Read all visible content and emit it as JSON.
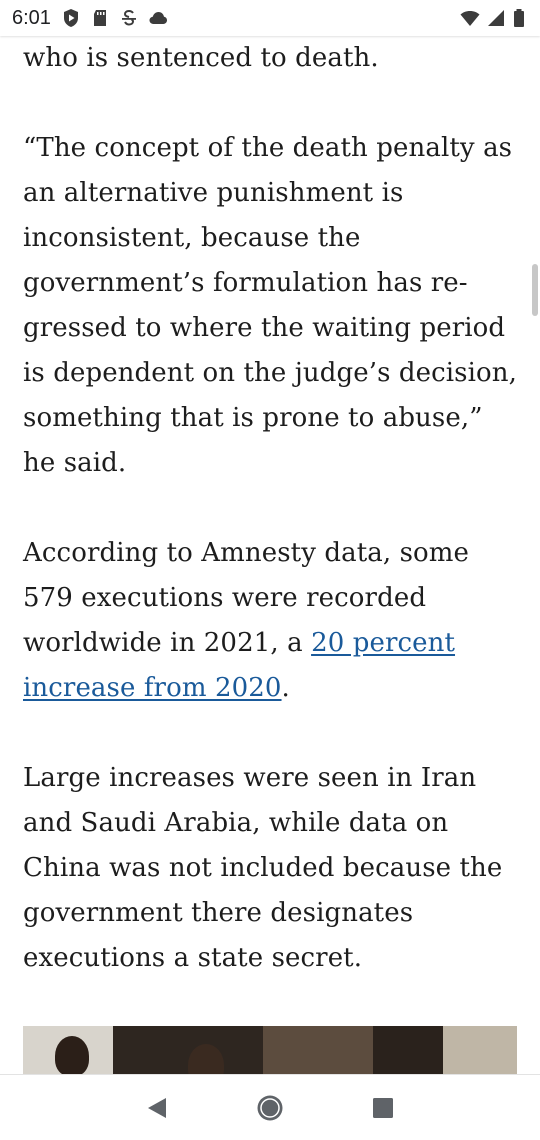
{
  "status_bar": {
    "time": "6:01",
    "left_icons": [
      "play-protect-icon",
      "sd-card-icon",
      "strikethrough-s-icon",
      "cloud-icon"
    ],
    "right_icons": [
      "wifi-icon",
      "cell-signal-icon",
      "battery-icon"
    ]
  },
  "article": {
    "paragraph_1": "who is sentenced to death.",
    "paragraph_2": "“The concept of the death penalty as an alternative punishment is inconsistent, because the government’s formulation has re-gressed to where the waiting period is dependent on the judge’s decision, something that is prone to abuse,” he said.",
    "paragraph_3_before": "According to Amnesty data, some 579 executions were recorded worldwide in 2021, a ",
    "paragraph_3_link": "20 percent increase from 2020",
    "paragraph_3_after": ".",
    "paragraph_4": "Large increases were seen in Iran and Saudi Arabia, while data on China was not included because the government there designates executions a state secret.",
    "link_color": "#1a5a9a"
  },
  "nav_bar": {
    "buttons": [
      "back-icon",
      "home-icon",
      "recents-icon"
    ]
  }
}
